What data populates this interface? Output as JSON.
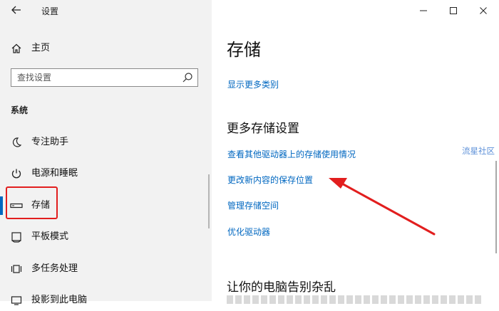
{
  "window": {
    "title": "设置",
    "controls": [
      "minimize",
      "maximize",
      "close"
    ]
  },
  "sidebar": {
    "home_label": "主页",
    "search": {
      "placeholder": "查找设置",
      "value": ""
    },
    "section_label": "系统",
    "items": [
      {
        "label": "专注助手",
        "icon": "moon-icon"
      },
      {
        "label": "电源和睡眠",
        "icon": "power-icon"
      },
      {
        "label": "存储",
        "icon": "storage-icon",
        "selected": true
      },
      {
        "label": "平板模式",
        "icon": "tablet-icon"
      },
      {
        "label": "多任务处理",
        "icon": "multitask-icon"
      },
      {
        "label": "投影到此电脑",
        "icon": "projector-icon"
      }
    ]
  },
  "main": {
    "title": "存储",
    "show_more_link": "显示更多类别",
    "more_settings_heading": "更多存储设置",
    "links": [
      "查看其他驱动器上的存储使用情况",
      "更改新内容的保存位置",
      "管理存储空间",
      "优化驱动器"
    ],
    "declutter_heading": "让你的电脑告别杂乱"
  },
  "watermark": "流星社区",
  "colors": {
    "accent": "#0067c0",
    "annotation": "#e21e1e",
    "sidebar_bg": "#f2f2f2"
  }
}
